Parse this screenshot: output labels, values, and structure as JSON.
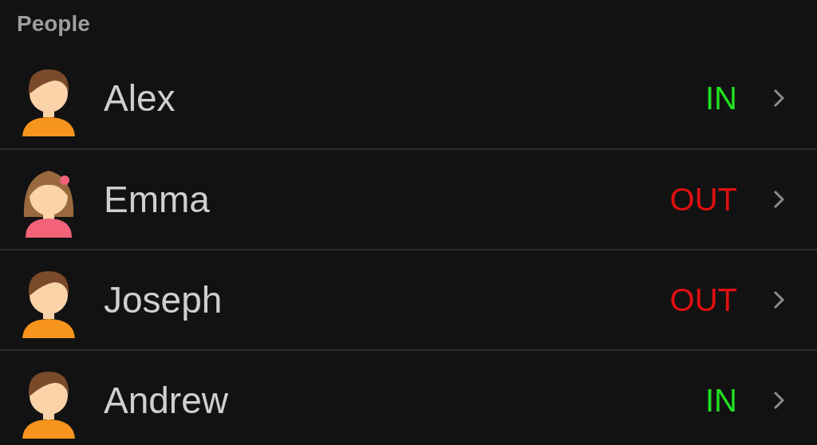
{
  "section": {
    "title": "People"
  },
  "people": [
    {
      "name": "Alex",
      "kind": "boy",
      "status": "IN",
      "color": "#22e022"
    },
    {
      "name": "Emma",
      "kind": "girl",
      "status": "OUT",
      "color": "#e01010"
    },
    {
      "name": "Joseph",
      "kind": "boy",
      "status": "OUT",
      "color": "#e01010"
    },
    {
      "name": "Andrew",
      "kind": "boy",
      "status": "IN",
      "color": "#22e022"
    }
  ]
}
